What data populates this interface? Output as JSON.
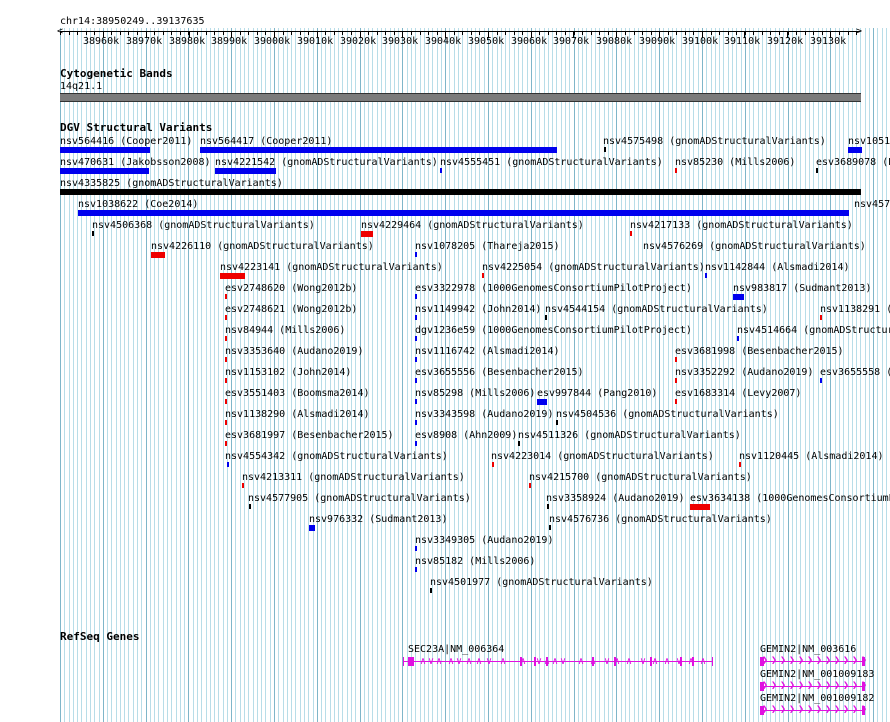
{
  "ruler": {
    "locus": "chr14:38950249..39137635",
    "ticks": [
      "38960k",
      "38970k",
      "38980k",
      "38990k",
      "39000k",
      "39010k",
      "39020k",
      "39030k",
      "39040k",
      "39050k",
      "39060k",
      "39070k",
      "39080k",
      "39090k",
      "39100k",
      "39110k",
      "39120k",
      "39130k"
    ]
  },
  "cyto": {
    "title": "Cytogenetic Bands",
    "band": "14q21.1"
  },
  "dgv": {
    "title": "DGV Structural Variants",
    "labels": [
      "nsv564416 (Cooper2011)",
      "nsv564417 (Cooper2011)",
      "nsv4575498 (gnomADStructuralVariants)",
      "nsv1051",
      "nsv470631 (Jakobsson2008)",
      "nsv4221542 (gnomADStructuralVariants)",
      "nsv4555451 (gnomADStructuralVariants)",
      "nsv85230 (Mills2006)",
      "esv3689078 (B",
      "nsv4335825 (gnomADStructuralVariants)",
      "nsv1038622 (Coe2014)",
      "nsv457",
      "nsv4506368 (gnomADStructuralVariants)",
      "nsv4229464 (gnomADStructuralVariants)",
      "nsv4217133 (gnomADStructuralVariants)",
      "nsv4226110 (gnomADStructuralVariants)",
      "nsv1078205 (Thareja2015)",
      "nsv4576269 (gnomADStructuralVariants)",
      "nsv4223141 (gnomADStructuralVariants)",
      "nsv4225054 (gnomADStructuralVariants)",
      "nsv1142844 (Alsmadi2014)",
      "esv2748620 (Wong2012b)",
      "esv3322978 (1000GenomesConsortiumPilotProject)",
      "nsv983817 (Sudmant2013)",
      "esv2748621 (Wong2012b)",
      "nsv1149942 (John2014)",
      "nsv4544154 (gnomADStructuralVariants)",
      "nsv1138291 (",
      "nsv84944 (Mills2006)",
      "dgv1236e59 (1000GenomesConsortiumPilotProject)",
      "nsv4514664 (gnomADStructuralVa",
      "nsv3353640 (Audano2019)",
      "nsv1116742 (Alsmadi2014)",
      "esv3681998 (Besenbacher2015)",
      "nsv1153102 (John2014)",
      "esv3655556 (Besenbacher2015)",
      "nsv3352292 (Audano2019)",
      "esv3655558 (",
      "esv3551403 (Boomsma2014)",
      "nsv85298 (Mills2006)",
      "esv997844 (Pang2010)",
      "esv1683314 (Levy2007)",
      "nsv1138290 (Alsmadi2014)",
      "nsv3343598 (Audano2019)",
      "nsv4504536 (gnomADStructuralVariants)",
      "esv3681997 (Besenbacher2015)",
      "esv8908 (Ahn2009)",
      "nsv4511326 (gnomADStructuralVariants)",
      "nsv4554342 (gnomADStructuralVariants)",
      "nsv4223014 (gnomADStructuralVariants)",
      "nsv1120445 (Alsmadi2014)",
      "nsv4213311 (gnomADStructuralVariants)",
      "nsv4215700 (gnomADStructuralVariants)",
      "nsv4577905 (gnomADStructuralVariants)",
      "nsv3358924 (Audano2019)",
      "esv3634138 (1000GenomesConsortiumP",
      "nsv976332 (Sudmant2013)",
      "nsv4576736 (gnomADStructuralVariants)",
      "nsv3349305 (Audano2019)",
      "nsv85182 (Mills2006)",
      "nsv4501977 (gnomADStructuralVariants)"
    ]
  },
  "refseq": {
    "title": "RefSeq Genes",
    "genes": [
      "SEC23A|NM_006364",
      "GEMIN2|NM_003616",
      "GEMIN2|NM_001009183",
      "GEMIN2|NM_001009182"
    ]
  },
  "colors": {
    "gain": "#0000ee",
    "loss": "#ee0000",
    "complex": "#000000",
    "gene": "#e010e0",
    "grid": "#b8dde8"
  }
}
